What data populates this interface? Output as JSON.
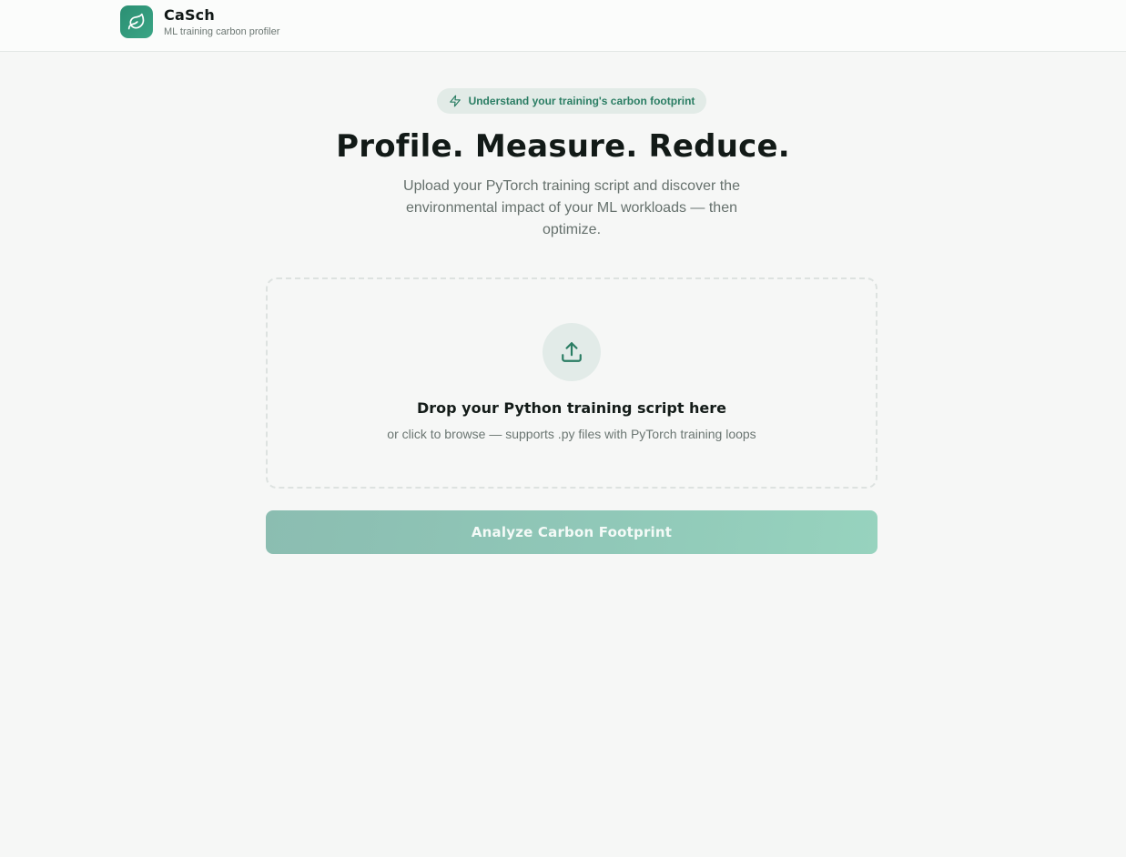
{
  "header": {
    "app_name": "CaSch",
    "tagline": "ML training carbon profiler",
    "logo_icon": "leaf-icon"
  },
  "hero": {
    "badge_icon": "lightning-icon",
    "badge_text": "Understand your training's carbon footprint",
    "title": "Profile. Measure. Reduce.",
    "subtitle": "Upload your PyTorch training script and discover the environmental impact of your ML workloads — then optimize."
  },
  "dropzone": {
    "icon": "upload-icon",
    "title": "Drop your Python training script here",
    "hint": "or click to browse — supports .py files with PyTorch training loops"
  },
  "actions": {
    "analyze_label": "Analyze Carbon Footprint",
    "analyze_disabled": true
  },
  "colors": {
    "accent": "#2b8f73",
    "accent_text": "#2a7d63",
    "background": "#f6f7f6",
    "button_disabled_start": "#8bbdb1",
    "button_disabled_end": "#97d3be"
  }
}
